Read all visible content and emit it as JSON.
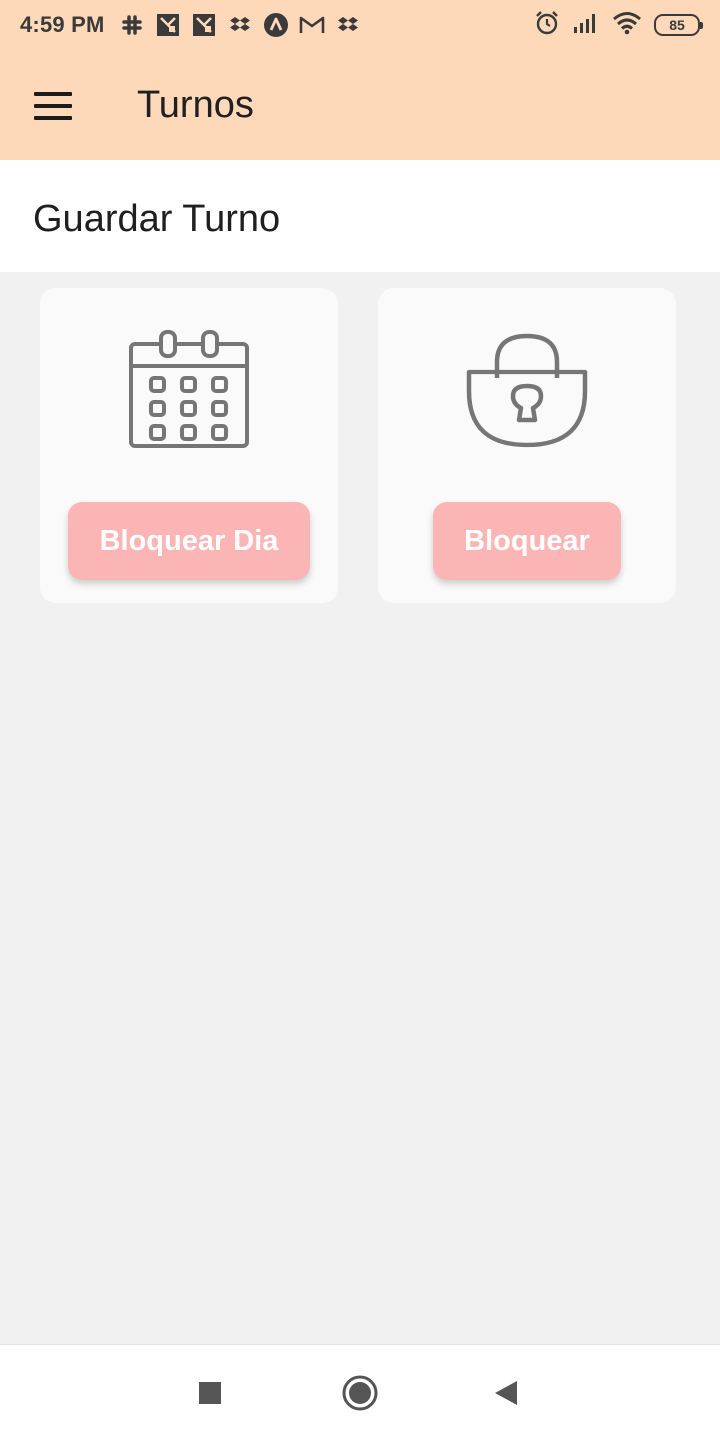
{
  "status_bar": {
    "time": "4:59 PM",
    "battery": "85",
    "notification_icons": [
      "slack-icon",
      "app-notification-icon",
      "app-notification-icon",
      "dropbox-icon",
      "arrow-circle-icon",
      "gmail-icon",
      "dropbox-icon"
    ],
    "system_icons": [
      "alarm-icon",
      "signal-icon",
      "wifi-icon",
      "battery-icon"
    ]
  },
  "app_bar": {
    "title": "Turnos",
    "menu_icon": "menu-icon",
    "background": "#fed9b9"
  },
  "section": {
    "title": "Guardar Turno"
  },
  "cards": [
    {
      "icon": "calendar-icon",
      "button_label": "Bloquear Dia"
    },
    {
      "icon": "lock-icon",
      "button_label": "Bloquear"
    }
  ],
  "colors": {
    "accent_button": "#fcb5b5",
    "header": "#fed9b9",
    "background": "#f1f1f1"
  },
  "nav_bar": {
    "buttons": [
      "recents-icon",
      "home-icon",
      "back-icon"
    ]
  }
}
